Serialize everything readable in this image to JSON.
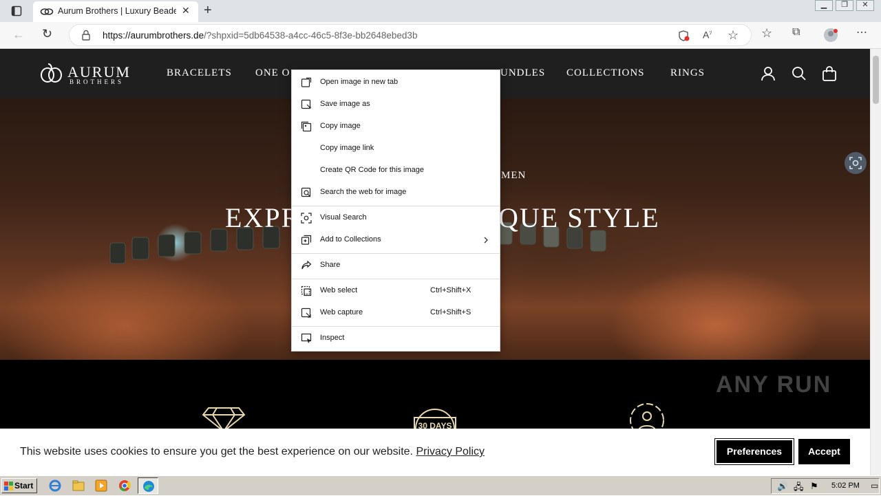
{
  "browser": {
    "tab_title": "Aurum Brothers | Luxury Beaded",
    "url_domain": "https://aurumbrothers.de",
    "url_rest": "/?shpxid=5db64538-a4cc-46c5-8f3e-bb2648ebed3b"
  },
  "site": {
    "logo_word": "AURUM",
    "logo_sub": "BROTHERS",
    "nav": [
      "BRACELETS",
      "ONE O",
      "UNDLES",
      "COLLECTIONS",
      "RINGS"
    ],
    "hero_subtitle_visible": "MEN",
    "hero_title_left": "EXPR",
    "hero_title_right": "QUE STYLE",
    "features": [
      {
        "icon": "diamond-icon"
      },
      {
        "icon": "30-days-return-icon",
        "label": "30 DAYS"
      },
      {
        "icon": "support-person-icon"
      }
    ]
  },
  "cookie": {
    "text": "This website uses cookies to ensure you get the best experience on our website.",
    "link": "Privacy Policy",
    "preferences": "Preferences",
    "accept": "Accept"
  },
  "context_menu": {
    "items": [
      {
        "label": "Open image in new tab",
        "icon": "open-image-icon"
      },
      {
        "label": "Save image as",
        "icon": "save-image-icon"
      },
      {
        "label": "Copy image",
        "icon": "copy-image-icon"
      },
      {
        "label": "Copy image link",
        "icon": ""
      },
      {
        "label": "Create QR Code for this image",
        "icon": ""
      },
      {
        "label": "Search the web for image",
        "icon": "search-image-icon"
      },
      {
        "label": "Visual Search",
        "icon": "visual-search-icon"
      },
      {
        "label": "Add to Collections",
        "icon": "collections-icon"
      },
      {
        "label": "Share",
        "icon": "share-icon"
      },
      {
        "label": "Web select",
        "icon": "web-select-icon",
        "shortcut": "Ctrl+Shift+X"
      },
      {
        "label": "Web capture",
        "icon": "web-capture-icon",
        "shortcut": "Ctrl+Shift+S"
      },
      {
        "label": "Inspect",
        "icon": "inspect-icon"
      }
    ]
  },
  "taskbar": {
    "start": "Start",
    "clock": "5:02 PM"
  },
  "watermark": "ANY RUN"
}
